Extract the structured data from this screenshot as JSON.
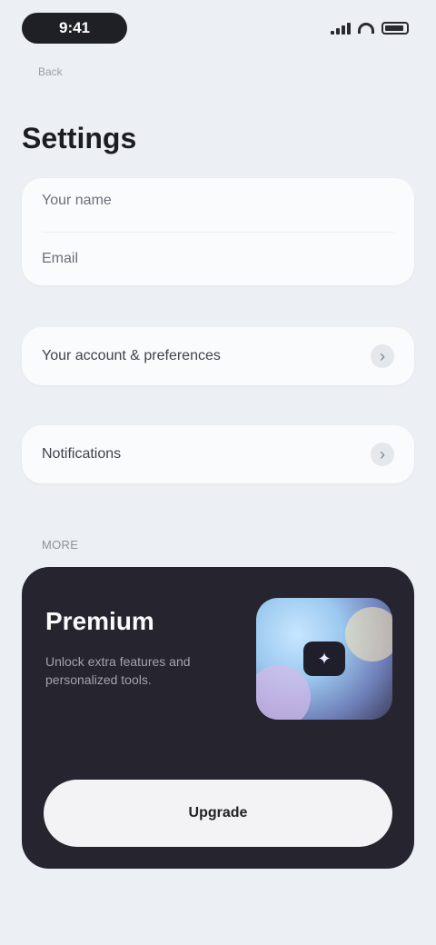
{
  "status_bar": {
    "time": "9:41"
  },
  "nav": {
    "back_label": "Back"
  },
  "page": {
    "title": "Settings"
  },
  "profile": {
    "name": "Your name",
    "email": "Email"
  },
  "rows": [
    {
      "label": "Your account & preferences"
    },
    {
      "label": "Notifications"
    }
  ],
  "section": {
    "header": "MORE"
  },
  "promo": {
    "title": "Premium",
    "description": "Unlock extra features and personalized tools.",
    "button_label": "Upgrade"
  },
  "colors": {
    "background": "#eceff3",
    "card": "#fafbfc",
    "promo_card": "#25242f",
    "promo_button": "#f3f3f5"
  },
  "icons": {
    "signal": "signal-icon",
    "wifi": "wifi-icon",
    "battery": "battery-icon",
    "chevron": "chevron-right-icon",
    "promo_art": "sparkle-art-icon"
  }
}
